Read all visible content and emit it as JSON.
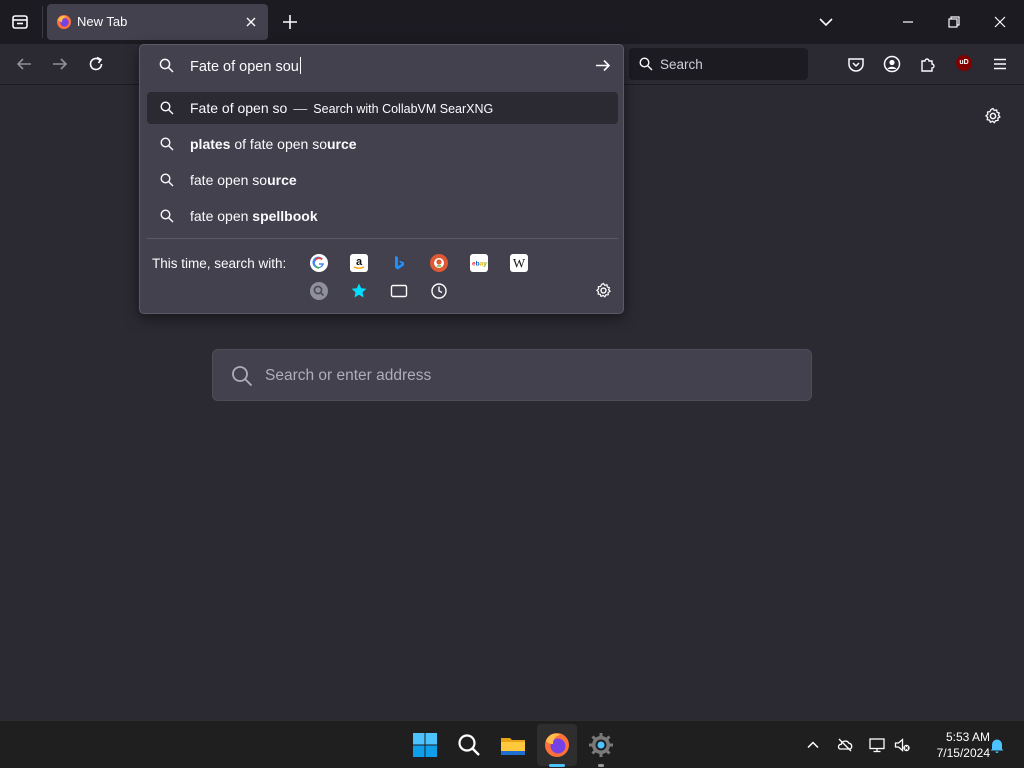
{
  "tab": {
    "title": "New Tab"
  },
  "toolbar": {
    "search_placeholder": "Search"
  },
  "urlbar": {
    "value": "Fate of open sou",
    "results": [
      {
        "type": "search-action",
        "text": "Fate of open so",
        "separator": "—",
        "action": "Search with CollabVM SearXNG"
      },
      {
        "type": "suggestion",
        "parts": [
          {
            "text": "plates",
            "bold": true
          },
          {
            "text": " of fate open so",
            "bold": false
          },
          {
            "text": "urce",
            "bold": true
          }
        ]
      },
      {
        "type": "suggestion",
        "parts": [
          {
            "text": "fate open so",
            "bold": false
          },
          {
            "text": "urce",
            "bold": true
          }
        ]
      },
      {
        "type": "suggestion",
        "parts": [
          {
            "text": "fate open ",
            "bold": false
          },
          {
            "text": "spellbook",
            "bold": true
          }
        ]
      }
    ],
    "oneoff_label": "This time, search with:",
    "engines": [
      "google",
      "amazon",
      "bing",
      "duckduckgo",
      "ebay",
      "wikipedia",
      "searxng",
      "bookmarks",
      "tabs",
      "history"
    ]
  },
  "page": {
    "search_placeholder": "Search or enter address"
  },
  "taskbar": {
    "time": "5:53 AM",
    "date": "7/15/2024"
  },
  "colors": {
    "accent": "#0a84ff",
    "ublock": "#800000",
    "selected_row": "#2b2a33",
    "popup_bg": "#42414d"
  }
}
